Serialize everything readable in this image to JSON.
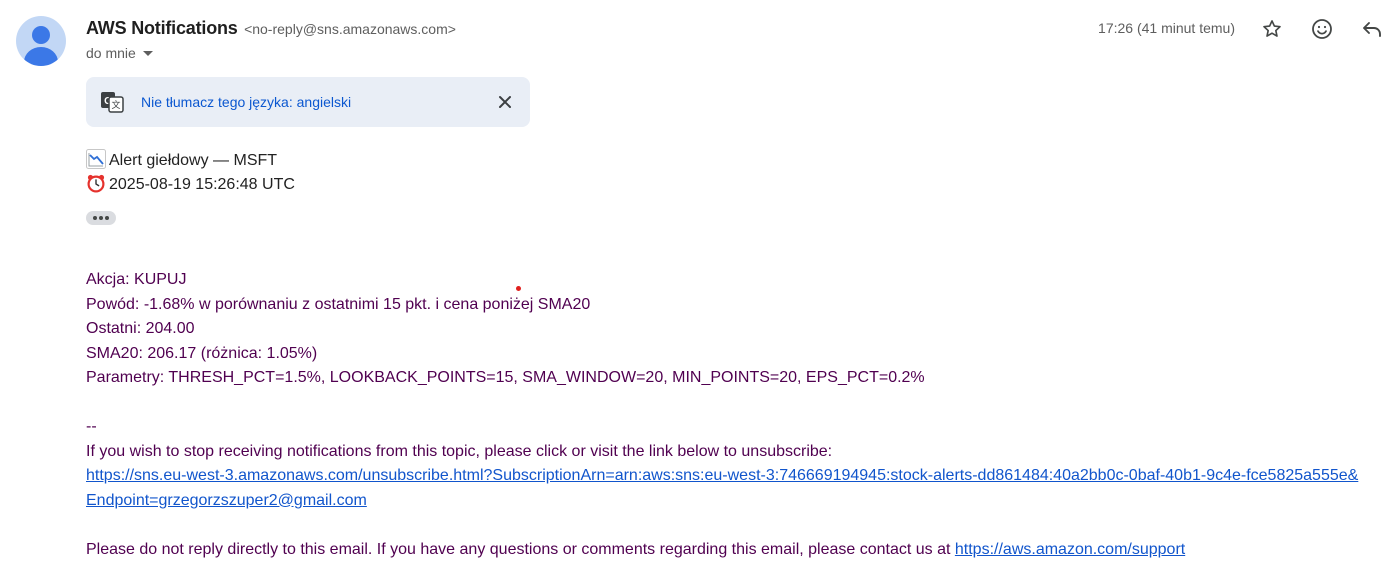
{
  "sender": {
    "name": "AWS Notifications",
    "email": "<no-reply@sns.amazonaws.com>",
    "recipient_label": "do mnie"
  },
  "header": {
    "timestamp": "17:26 (41 minut temu)",
    "icons": [
      "star-icon",
      "emoji-icon",
      "reply-icon"
    ]
  },
  "translate_bar": {
    "text": "Nie tłumacz tego języka: angielski",
    "icon": "translate-icon"
  },
  "alert": {
    "title": "Alert giełdowy — MSFT",
    "title_emoji": "chart-decreasing-icon",
    "datetime": "2025-08-19 15:26:48 UTC",
    "datetime_emoji": "alarm-clock-icon"
  },
  "body": {
    "action": "Akcja: KUPUJ",
    "reason": "Powód: -1.68% w porównaniu z ostatnimi 15 pkt. i cena poniżej SMA20",
    "last": "Ostatni: 204.00",
    "sma": "SMA20: 206.17 (różnica: 1.05%)",
    "params": "Parametry: THRESH_PCT=1.5%, LOOKBACK_POINTS=15, SMA_WINDOW=20, MIN_POINTS=20, EPS_PCT=0.2%",
    "separator": "--",
    "unsubscribe_text": "If you wish to stop receiving notifications from this topic, please click or visit the link below to unsubscribe:",
    "unsubscribe_link_line1": "https://sns.eu-west-3.amazonaws.com/unsubscribe.html?SubscriptionArn=arn:aws:sns:eu-west-3:746669194945:stock-alerts-dd861484:40a2bb0c-0baf-40b1-9c4e-fce5825a555e&",
    "unsubscribe_link_line2": "Endpoint=grzegorzszuper2@gmail.com",
    "footer_text": "Please do not reply directly to this email. If you have any questions or comments regarding this email, please contact us at ",
    "support_link": "https://aws.amazon.com/support"
  },
  "colors": {
    "body_text": "#500050",
    "link": "#1155cc",
    "translate_bar_bg": "#e9eef6",
    "translate_link": "#0b57d0",
    "avatar_bg": "#c2d7f5",
    "avatar_fg": "#3b78e7"
  }
}
